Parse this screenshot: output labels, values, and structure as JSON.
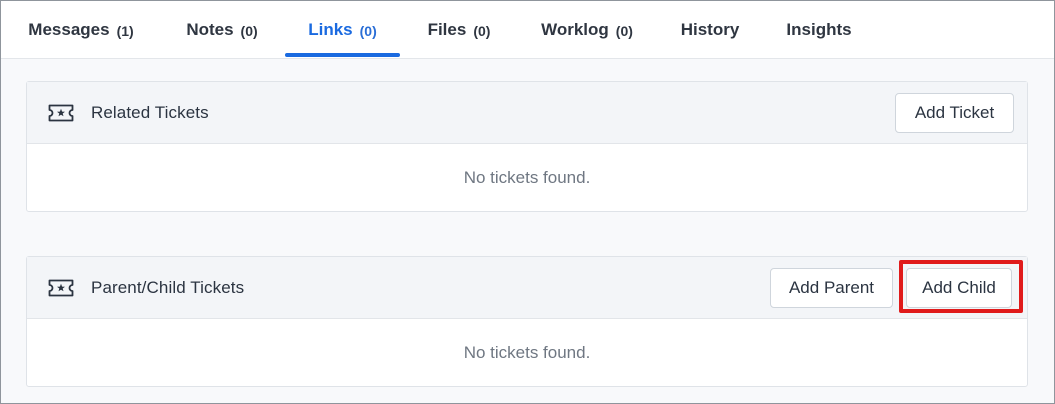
{
  "tabs": [
    {
      "label": "Messages",
      "count": "(1)",
      "active": false
    },
    {
      "label": "Notes",
      "count": "(0)",
      "active": false
    },
    {
      "label": "Links",
      "count": "(0)",
      "active": true
    },
    {
      "label": "Files",
      "count": "(0)",
      "active": false
    },
    {
      "label": "Worklog",
      "count": "(0)",
      "active": false
    },
    {
      "label": "History",
      "count": "",
      "active": false
    },
    {
      "label": "Insights",
      "count": "",
      "active": false
    }
  ],
  "related": {
    "icon": "ticket-icon",
    "title": "Related Tickets",
    "add_ticket_label": "Add Ticket",
    "empty_text": "No tickets found."
  },
  "parent_child": {
    "icon": "ticket-icon",
    "title": "Parent/Child Tickets",
    "add_parent_label": "Add Parent",
    "add_child_label": "Add Child",
    "empty_text": "No tickets found."
  },
  "colors": {
    "accent": "#1a6ae0",
    "highlight": "#e01b1b"
  }
}
